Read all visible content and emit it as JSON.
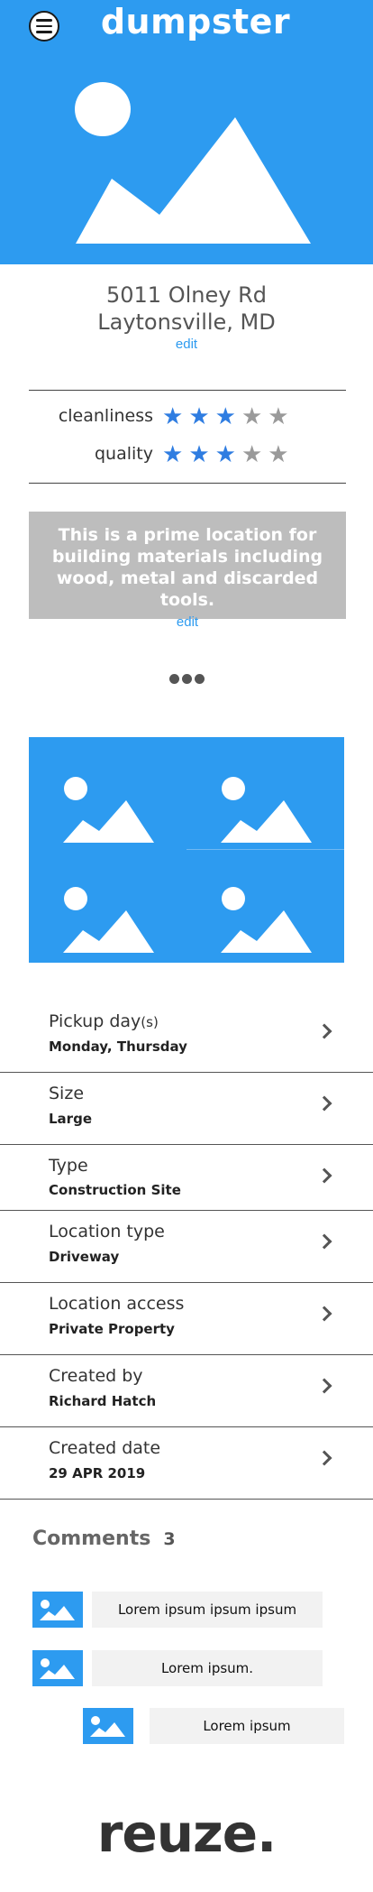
{
  "header": {
    "title": "dumpster",
    "menu_icon": "hamburger-menu-icon"
  },
  "hero": {
    "image_icon": "image-placeholder-icon",
    "color": "#2d9bf0"
  },
  "address": {
    "line1": "5011 Olney Rd",
    "line2": "Laytonsville, MD",
    "edit_label": "edit"
  },
  "ratings": [
    {
      "label": "cleanliness",
      "stars": 3,
      "max": 5
    },
    {
      "label": "quality",
      "stars": 3,
      "max": 5
    }
  ],
  "description": {
    "text": "This is a prime location for building materials including wood, metal and discarded tools.",
    "edit_label": "edit"
  },
  "more_icon": "more-dots-icon",
  "details": [
    {
      "label": "Pickup day",
      "label_suffix": "(s)",
      "value": "Monday, Thursday"
    },
    {
      "label": "Size",
      "label_suffix": "",
      "value": "Large"
    },
    {
      "label": "Type",
      "label_suffix": "",
      "value": "Construction Site"
    },
    {
      "label": "Location type",
      "label_suffix": "",
      "value": "Driveway"
    },
    {
      "label": "Location access",
      "label_suffix": "",
      "value": "Private Property"
    },
    {
      "label": "Created by",
      "label_suffix": "",
      "value": "Richard Hatch"
    },
    {
      "label": "Created date",
      "label_suffix": "",
      "value": "29 APR 2019"
    }
  ],
  "comments": {
    "title": "Comments",
    "count": "3",
    "items": [
      {
        "text": "Lorem ipsum ipsum ipsum"
      },
      {
        "text": "Lorem ipsum."
      },
      {
        "text": "Lorem ipsum"
      }
    ]
  },
  "footer": {
    "brand": "reuze."
  },
  "colors": {
    "accent": "#2d9bf0",
    "star_on": "#2f7de1",
    "star_off": "#9a9a9a",
    "desc_bg": "#bdbdbd"
  }
}
